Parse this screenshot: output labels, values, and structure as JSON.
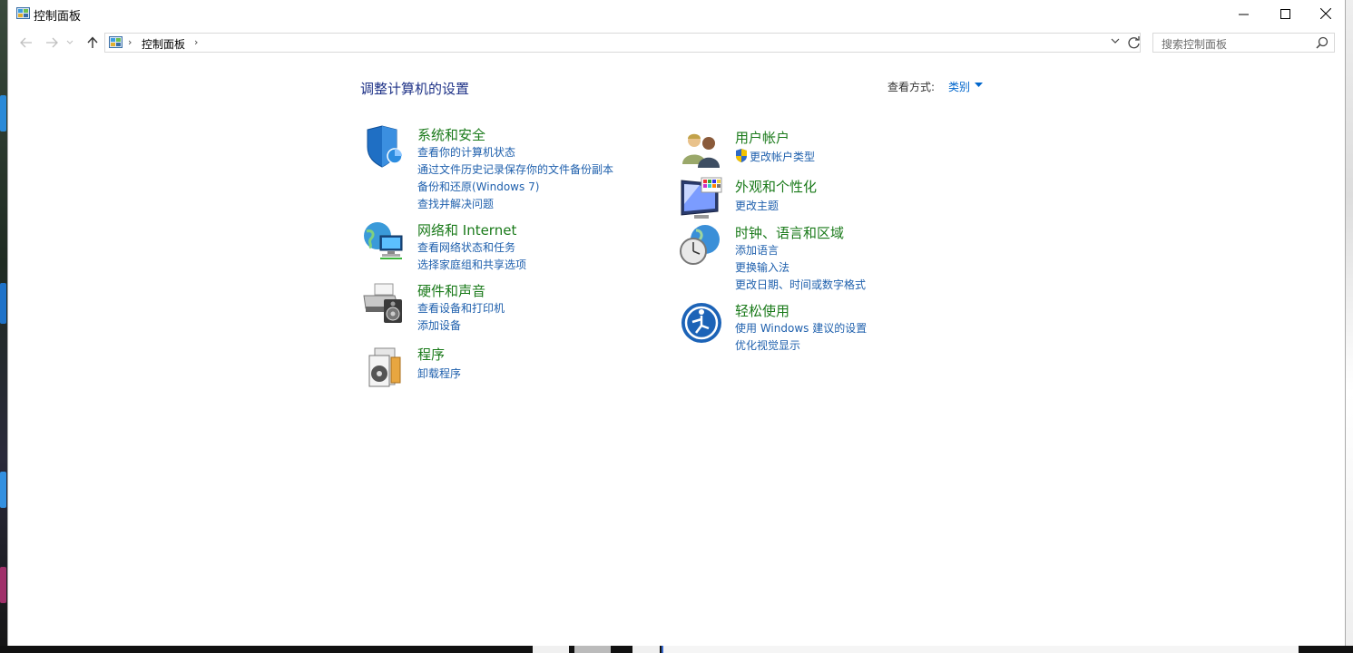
{
  "window": {
    "title": "控制面板"
  },
  "caption_buttons": {
    "minimize": "—",
    "maximize": "☐",
    "close": "✕"
  },
  "address": {
    "crumb": "控制面板"
  },
  "search": {
    "placeholder": "搜索控制面板"
  },
  "page": {
    "title": "调整计算机的设置",
    "viewby_label": "查看方式:",
    "viewby_value": "类别"
  },
  "categories": [
    {
      "title": "系统和安全",
      "icon": "shield-icon",
      "links": [
        "查看你的计算机状态",
        "通过文件历史记录保存你的文件备份副本",
        "备份和还原(Windows 7)",
        "查找并解决问题"
      ]
    },
    {
      "title": "网络和 Internet",
      "icon": "network-icon",
      "links": [
        "查看网络状态和任务",
        "选择家庭组和共享选项"
      ]
    },
    {
      "title": "硬件和声音",
      "icon": "printer-icon",
      "links": [
        "查看设备和打印机",
        "添加设备"
      ]
    },
    {
      "title": "程序",
      "icon": "programs-icon",
      "links": [
        "卸载程序"
      ]
    },
    {
      "title": "用户帐户",
      "icon": "users-icon",
      "links": [
        "更改帐户类型"
      ]
    },
    {
      "title": "外观和个性化",
      "icon": "monitor-icon",
      "links": [
        "更改主题"
      ]
    },
    {
      "title": "时钟、语言和区域",
      "icon": "clock-globe-icon",
      "links": [
        "添加语言",
        "更换输入法",
        "更改日期、时间或数字格式"
      ]
    },
    {
      "title": "轻松使用",
      "icon": "accessibility-icon",
      "links": [
        "使用 Windows 建议的设置",
        "优化视觉显示"
      ]
    }
  ],
  "colors": {
    "category_title": "#1a7a1a",
    "link": "#1f60ad",
    "page_title": "#1e3287",
    "accent": "#0066cc"
  }
}
